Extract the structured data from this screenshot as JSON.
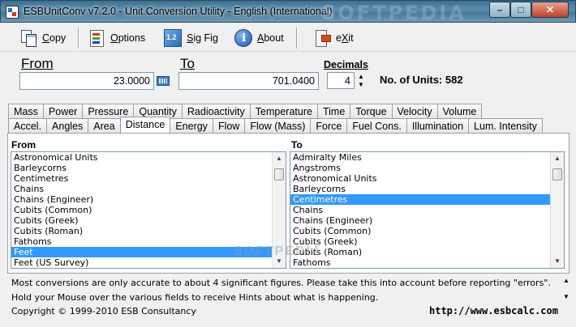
{
  "window": {
    "title": "ESBUnitConv v7.2.0 - Unit Conversion Utility - English (International)",
    "watermark": "SOFTPEDIA",
    "controls": {
      "minimize": "–",
      "maximize": "□",
      "close": "✕"
    }
  },
  "toolbar": {
    "copy": {
      "hotkey": "C",
      "rest": "opy",
      "icon": "copy-icon"
    },
    "options": {
      "hotkey": "O",
      "rest": "ptions",
      "icon": "options-icon"
    },
    "sigfig": {
      "hotkey": "S",
      "rest": "ig Fig",
      "icon": "sigfig-icon"
    },
    "about": {
      "hotkey": "A",
      "rest": "bout",
      "icon": "about-icon"
    },
    "exit": {
      "pre": "e",
      "hotkey": "X",
      "rest": "it",
      "icon": "exit-icon"
    }
  },
  "conversion": {
    "from_label": "From",
    "from_value": "23.0000",
    "to_label": "To",
    "to_value": "701.0400",
    "decimals_label": "Decimals",
    "decimals_value": "4",
    "units_count_text": "No. of Units: 582"
  },
  "tabs_row1": [
    "Mass",
    "Power",
    "Pressure",
    "Quantity",
    "Radioactivity",
    "Temperature",
    "Time",
    "Torque",
    "Velocity",
    "Volume"
  ],
  "tabs_row2": [
    "Accel.",
    "Angles",
    "Area",
    "Distance",
    "Energy",
    "Flow",
    "Flow (Mass)",
    "Force",
    "Fuel Cons.",
    "Illumination",
    "Lum. Intensity"
  ],
  "active_tab": "Distance",
  "from_list": {
    "title": "From",
    "items": [
      "Astronomical Units",
      "Barleycorns",
      "Centimetres",
      "Chains",
      "Chains (Engineer)",
      "Cubits (Common)",
      "Cubits (Greek)",
      "Cubits (Roman)",
      "Fathoms",
      "Feet",
      "Feet (US Survey)"
    ],
    "selected": "Feet"
  },
  "to_list": {
    "title": "To",
    "items": [
      "Admiralty Miles",
      "Angstroms",
      "Astronomical Units",
      "Barleycorns",
      "Centimetres",
      "Chains",
      "Chains (Engineer)",
      "Cubits (Common)",
      "Cubits (Greek)",
      "Cubits (Roman)",
      "Fathoms"
    ],
    "selected": "Centimetres"
  },
  "hints": {
    "line1": "Most conversions are only accurate to about 4 significant figures. Please take this into account before reporting \"errors\".",
    "line2": "Hold your Mouse over the various fields to receive Hints about what is happening."
  },
  "footer": {
    "copyright": "Copyright © 1999-2010 ESB Consultancy",
    "url": "http://www.esbcalc.com"
  },
  "colors": {
    "selection": "#3399ff",
    "title_bar": "#4b7a98"
  }
}
